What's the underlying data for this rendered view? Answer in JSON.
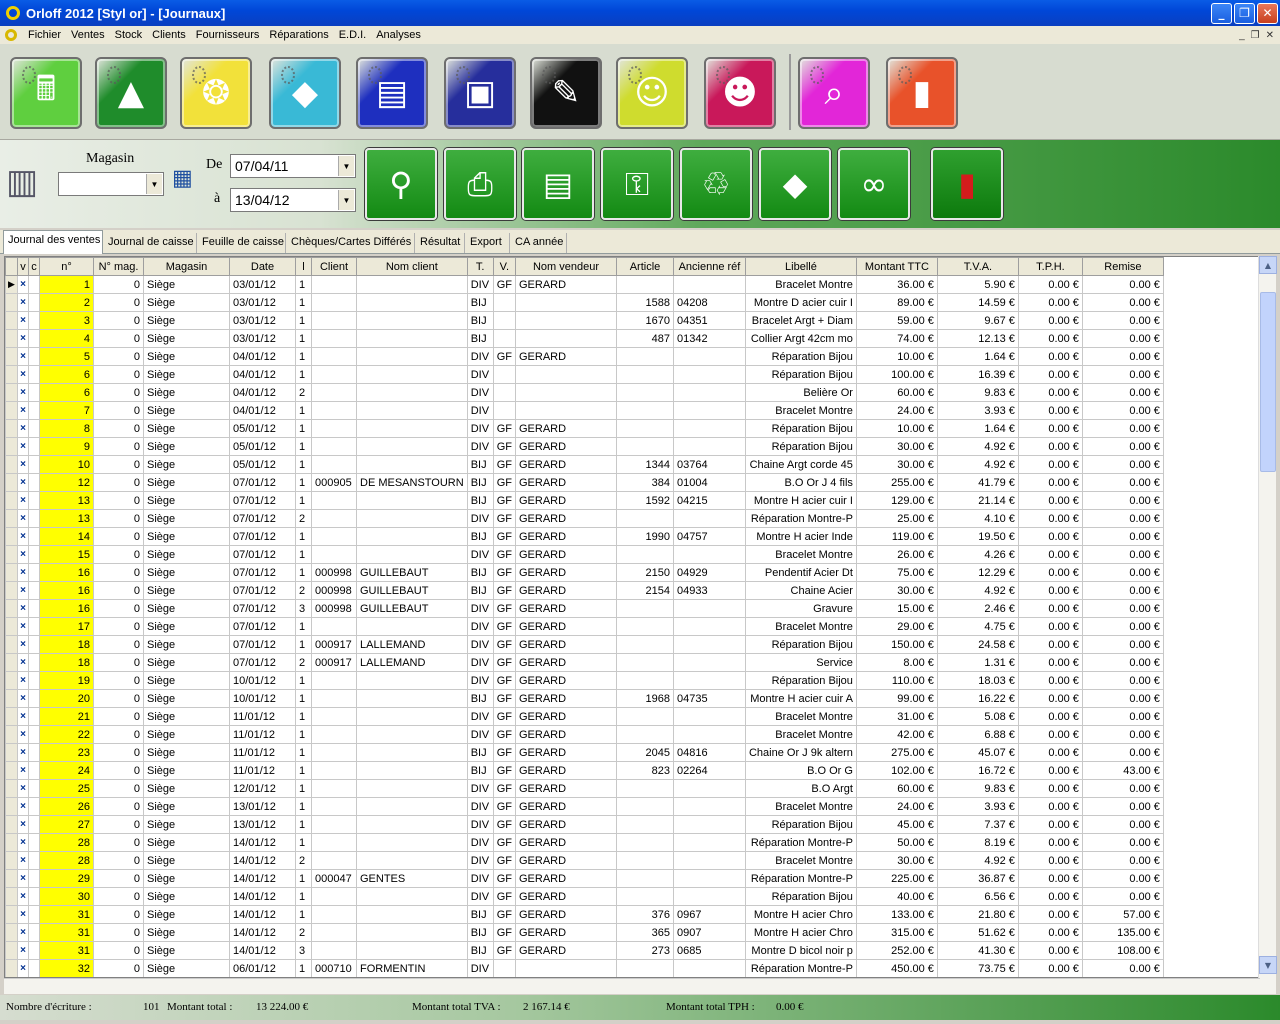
{
  "window": {
    "title": "Orloff 2012 [Styl or] - [Journaux]"
  },
  "menu": [
    "Fichier",
    "Ventes",
    "Stock",
    "Clients",
    "Fournisseurs",
    "Réparations",
    "E.D.I.",
    "Analyses"
  ],
  "toolbar": [
    {
      "icon": "cash-register-icon",
      "color": "#5fcf3f",
      "glyph": "🖩"
    },
    {
      "icon": "pyramid-icon",
      "color": "#1f8c2b",
      "glyph": "▲"
    },
    {
      "icon": "gold-jewelry-icon",
      "color": "#f2e13a",
      "glyph": "❂"
    },
    {
      "icon": "diamond-icon",
      "color": "#39b9d6",
      "glyph": "◆"
    },
    {
      "icon": "clipboard-icon",
      "color": "#1e2fbf",
      "glyph": "▤"
    },
    {
      "icon": "safe-icon",
      "color": "#262e9c",
      "glyph": "▣"
    },
    {
      "icon": "toolbox-icon",
      "color": "#111111",
      "glyph": "✎"
    },
    {
      "icon": "customers-icon",
      "color": "#cfdc2e",
      "glyph": "☺"
    },
    {
      "icon": "group-icon",
      "color": "#c9185a",
      "glyph": "☻"
    },
    {
      "icon": "analysis-icon",
      "color": "#e226d8",
      "glyph": "⌕"
    },
    {
      "icon": "exit-door-icon",
      "color": "#e8522a",
      "glyph": "▮"
    }
  ],
  "filter": {
    "magasin_label": "Magasin",
    "magasin_value": "",
    "from_label": "De",
    "from_value": "07/04/11",
    "to_label": "à",
    "to_value": "13/04/12"
  },
  "actions": [
    {
      "icon": "search-icon",
      "glyph": "⚲"
    },
    {
      "icon": "printer-icon",
      "glyph": "⎙"
    },
    {
      "icon": "print-report-icon",
      "glyph": "▤"
    },
    {
      "icon": "lock-export-icon",
      "glyph": "⚿"
    },
    {
      "icon": "trash-icon",
      "glyph": "♲"
    },
    {
      "icon": "diamond-search-icon",
      "glyph": "◆"
    },
    {
      "icon": "binoculars-icon",
      "glyph": "∞"
    },
    {
      "icon": "close-door-icon",
      "glyph": "▮"
    }
  ],
  "tabs": [
    "Journal des ventes",
    "Journal de caisse",
    "Feuille de caisse",
    "Chèques/Cartes Différés",
    "Résultat",
    "Export",
    "CA année"
  ],
  "columns": [
    "v",
    "c",
    "n°",
    "N° mag.",
    "Magasin",
    "Date",
    "l",
    "Client",
    "Nom client",
    "T.",
    "V.",
    "Nom vendeur",
    "Article",
    "Ancienne réf",
    "Libellé",
    "Montant TTC",
    "T.V.A.",
    "T.P.H.",
    "Remise"
  ],
  "rows": [
    [
      "1",
      "0",
      "Siège",
      "03/01/12",
      "1",
      "",
      "",
      "DIV",
      "GF",
      "GERARD",
      "",
      "",
      "Bracelet Montre",
      "36.00 €",
      "5.90 €",
      "0.00 €",
      "0.00 €"
    ],
    [
      "2",
      "0",
      "Siège",
      "03/01/12",
      "1",
      "",
      "",
      "BIJ",
      "",
      "",
      "1588",
      "04208",
      "Montre D acier cuir I",
      "89.00 €",
      "14.59 €",
      "0.00 €",
      "0.00 €"
    ],
    [
      "3",
      "0",
      "Siège",
      "03/01/12",
      "1",
      "",
      "",
      "BIJ",
      "",
      "",
      "1670",
      "04351",
      "Bracelet Argt + Diam",
      "59.00 €",
      "9.67 €",
      "0.00 €",
      "0.00 €"
    ],
    [
      "4",
      "0",
      "Siège",
      "03/01/12",
      "1",
      "",
      "",
      "BIJ",
      "",
      "",
      "487",
      "01342",
      "Collier Argt 42cm mo",
      "74.00 €",
      "12.13 €",
      "0.00 €",
      "0.00 €"
    ],
    [
      "5",
      "0",
      "Siège",
      "04/01/12",
      "1",
      "",
      "",
      "DIV",
      "GF",
      "GERARD",
      "",
      "",
      "Réparation Bijou",
      "10.00 €",
      "1.64 €",
      "0.00 €",
      "0.00 €"
    ],
    [
      "6",
      "0",
      "Siège",
      "04/01/12",
      "1",
      "",
      "",
      "DIV",
      "",
      "",
      "",
      "",
      "Réparation Bijou",
      "100.00 €",
      "16.39 €",
      "0.00 €",
      "0.00 €"
    ],
    [
      "6",
      "0",
      "Siège",
      "04/01/12",
      "2",
      "",
      "",
      "DIV",
      "",
      "",
      "",
      "",
      "Belière Or",
      "60.00 €",
      "9.83 €",
      "0.00 €",
      "0.00 €"
    ],
    [
      "7",
      "0",
      "Siège",
      "04/01/12",
      "1",
      "",
      "",
      "DIV",
      "",
      "",
      "",
      "",
      "Bracelet Montre",
      "24.00 €",
      "3.93 €",
      "0.00 €",
      "0.00 €"
    ],
    [
      "8",
      "0",
      "Siège",
      "05/01/12",
      "1",
      "",
      "",
      "DIV",
      "GF",
      "GERARD",
      "",
      "",
      "Réparation Bijou",
      "10.00 €",
      "1.64 €",
      "0.00 €",
      "0.00 €"
    ],
    [
      "9",
      "0",
      "Siège",
      "05/01/12",
      "1",
      "",
      "",
      "DIV",
      "GF",
      "GERARD",
      "",
      "",
      "Réparation Bijou",
      "30.00 €",
      "4.92 €",
      "0.00 €",
      "0.00 €"
    ],
    [
      "10",
      "0",
      "Siège",
      "05/01/12",
      "1",
      "",
      "",
      "BIJ",
      "GF",
      "GERARD",
      "1344",
      "03764",
      "Chaine Argt corde 45",
      "30.00 €",
      "4.92 €",
      "0.00 €",
      "0.00 €"
    ],
    [
      "12",
      "0",
      "Siège",
      "07/01/12",
      "1",
      "000905",
      "DE MESANSTOURN",
      "BIJ",
      "GF",
      "GERARD",
      "384",
      "01004",
      "B.O Or J   4 fils",
      "255.00 €",
      "41.79 €",
      "0.00 €",
      "0.00 €"
    ],
    [
      "13",
      "0",
      "Siège",
      "07/01/12",
      "1",
      "",
      "",
      "BIJ",
      "GF",
      "GERARD",
      "1592",
      "04215",
      "Montre H acier cuir I",
      "129.00 €",
      "21.14 €",
      "0.00 €",
      "0.00 €"
    ],
    [
      "13",
      "0",
      "Siège",
      "07/01/12",
      "2",
      "",
      "",
      "DIV",
      "GF",
      "GERARD",
      "",
      "",
      "Réparation Montre-P",
      "25.00 €",
      "4.10 €",
      "0.00 €",
      "0.00 €"
    ],
    [
      "14",
      "0",
      "Siège",
      "07/01/12",
      "1",
      "",
      "",
      "BIJ",
      "GF",
      "GERARD",
      "1990",
      "04757",
      "Montre H acier  Inde",
      "119.00 €",
      "19.50 €",
      "0.00 €",
      "0.00 €"
    ],
    [
      "15",
      "0",
      "Siège",
      "07/01/12",
      "1",
      "",
      "",
      "DIV",
      "GF",
      "GERARD",
      "",
      "",
      "Bracelet Montre",
      "26.00 €",
      "4.26 €",
      "0.00 €",
      "0.00 €"
    ],
    [
      "16",
      "0",
      "Siège",
      "07/01/12",
      "1",
      "000998",
      "GUILLEBAUT",
      "BIJ",
      "GF",
      "GERARD",
      "2150",
      "04929",
      "Pendentif Acier Dt",
      "75.00 €",
      "12.29 €",
      "0.00 €",
      "0.00 €"
    ],
    [
      "16",
      "0",
      "Siège",
      "07/01/12",
      "2",
      "000998",
      "GUILLEBAUT",
      "BIJ",
      "GF",
      "GERARD",
      "2154",
      "04933",
      "Chaine Acier",
      "30.00 €",
      "4.92 €",
      "0.00 €",
      "0.00 €"
    ],
    [
      "16",
      "0",
      "Siège",
      "07/01/12",
      "3",
      "000998",
      "GUILLEBAUT",
      "DIV",
      "GF",
      "GERARD",
      "",
      "",
      "Gravure",
      "15.00 €",
      "2.46 €",
      "0.00 €",
      "0.00 €"
    ],
    [
      "17",
      "0",
      "Siège",
      "07/01/12",
      "1",
      "",
      "",
      "DIV",
      "GF",
      "GERARD",
      "",
      "",
      "Bracelet Montre",
      "29.00 €",
      "4.75 €",
      "0.00 €",
      "0.00 €"
    ],
    [
      "18",
      "0",
      "Siège",
      "07/01/12",
      "1",
      "000917",
      "LALLEMAND",
      "DIV",
      "GF",
      "GERARD",
      "",
      "",
      "Réparation Bijou",
      "150.00 €",
      "24.58 €",
      "0.00 €",
      "0.00 €"
    ],
    [
      "18",
      "0",
      "Siège",
      "07/01/12",
      "2",
      "000917",
      "LALLEMAND",
      "DIV",
      "GF",
      "GERARD",
      "",
      "",
      "Service",
      "8.00 €",
      "1.31 €",
      "0.00 €",
      "0.00 €"
    ],
    [
      "19",
      "0",
      "Siège",
      "10/01/12",
      "1",
      "",
      "",
      "DIV",
      "GF",
      "GERARD",
      "",
      "",
      "Réparation Bijou",
      "110.00 €",
      "18.03 €",
      "0.00 €",
      "0.00 €"
    ],
    [
      "20",
      "0",
      "Siège",
      "10/01/12",
      "1",
      "",
      "",
      "BIJ",
      "GF",
      "GERARD",
      "1968",
      "04735",
      "Montre H acier cuir A",
      "99.00 €",
      "16.22 €",
      "0.00 €",
      "0.00 €"
    ],
    [
      "21",
      "0",
      "Siège",
      "11/01/12",
      "1",
      "",
      "",
      "DIV",
      "GF",
      "GERARD",
      "",
      "",
      "Bracelet Montre",
      "31.00 €",
      "5.08 €",
      "0.00 €",
      "0.00 €"
    ],
    [
      "22",
      "0",
      "Siège",
      "11/01/12",
      "1",
      "",
      "",
      "DIV",
      "GF",
      "GERARD",
      "",
      "",
      "Bracelet Montre",
      "42.00 €",
      "6.88 €",
      "0.00 €",
      "0.00 €"
    ],
    [
      "23",
      "0",
      "Siège",
      "11/01/12",
      "1",
      "",
      "",
      "BIJ",
      "GF",
      "GERARD",
      "2045",
      "04816",
      "Chaine Or J 9k altern",
      "275.00 €",
      "45.07 €",
      "0.00 €",
      "0.00 €"
    ],
    [
      "24",
      "0",
      "Siège",
      "11/01/12",
      "1",
      "",
      "",
      "BIJ",
      "GF",
      "GERARD",
      "823",
      "02264",
      "B.O Or G",
      "102.00 €",
      "16.72 €",
      "0.00 €",
      "43.00 €"
    ],
    [
      "25",
      "0",
      "Siège",
      "12/01/12",
      "1",
      "",
      "",
      "DIV",
      "GF",
      "GERARD",
      "",
      "",
      "B.O Argt",
      "60.00 €",
      "9.83 €",
      "0.00 €",
      "0.00 €"
    ],
    [
      "26",
      "0",
      "Siège",
      "13/01/12",
      "1",
      "",
      "",
      "DIV",
      "GF",
      "GERARD",
      "",
      "",
      "Bracelet Montre",
      "24.00 €",
      "3.93 €",
      "0.00 €",
      "0.00 €"
    ],
    [
      "27",
      "0",
      "Siège",
      "13/01/12",
      "1",
      "",
      "",
      "DIV",
      "GF",
      "GERARD",
      "",
      "",
      "Réparation Bijou",
      "45.00 €",
      "7.37 €",
      "0.00 €",
      "0.00 €"
    ],
    [
      "28",
      "0",
      "Siège",
      "14/01/12",
      "1",
      "",
      "",
      "DIV",
      "GF",
      "GERARD",
      "",
      "",
      "Réparation Montre-P",
      "50.00 €",
      "8.19 €",
      "0.00 €",
      "0.00 €"
    ],
    [
      "28",
      "0",
      "Siège",
      "14/01/12",
      "2",
      "",
      "",
      "DIV",
      "GF",
      "GERARD",
      "",
      "",
      "Bracelet Montre",
      "30.00 €",
      "4.92 €",
      "0.00 €",
      "0.00 €"
    ],
    [
      "29",
      "0",
      "Siège",
      "14/01/12",
      "1",
      "000047",
      "GENTES",
      "DIV",
      "GF",
      "GERARD",
      "",
      "",
      "Réparation Montre-P",
      "225.00 €",
      "36.87 €",
      "0.00 €",
      "0.00 €"
    ],
    [
      "30",
      "0",
      "Siège",
      "14/01/12",
      "1",
      "",
      "",
      "DIV",
      "GF",
      "GERARD",
      "",
      "",
      "Réparation Bijou",
      "40.00 €",
      "6.56 €",
      "0.00 €",
      "0.00 €"
    ],
    [
      "31",
      "0",
      "Siège",
      "14/01/12",
      "1",
      "",
      "",
      "BIJ",
      "GF",
      "GERARD",
      "376",
      "0967",
      "Montre H acier Chro",
      "133.00 €",
      "21.80 €",
      "0.00 €",
      "57.00 €"
    ],
    [
      "31",
      "0",
      "Siège",
      "14/01/12",
      "2",
      "",
      "",
      "BIJ",
      "GF",
      "GERARD",
      "365",
      "0907",
      "Montre H acier Chro",
      "315.00 €",
      "51.62 €",
      "0.00 €",
      "135.00 €"
    ],
    [
      "31",
      "0",
      "Siège",
      "14/01/12",
      "3",
      "",
      "",
      "BIJ",
      "GF",
      "GERARD",
      "273",
      "0685",
      "Montre D bicol noir p",
      "252.00 €",
      "41.30 €",
      "0.00 €",
      "108.00 €"
    ],
    [
      "32",
      "0",
      "Siège",
      "06/01/12",
      "1",
      "000710",
      "FORMENTIN",
      "DIV",
      "",
      "",
      "",
      "",
      "Réparation Montre-P",
      "450.00 €",
      "73.75 €",
      "0.00 €",
      "0.00 €"
    ]
  ],
  "footer": {
    "count_label": "Nombre d'écriture :",
    "count_value": "101",
    "total_label": "Montant total :",
    "total_value": "13 224.00 €",
    "tva_label": "Montant total TVA :",
    "tva_value": "2 167.14 €",
    "tph_label": "Montant total TPH :",
    "tph_value": "0.00 €"
  }
}
